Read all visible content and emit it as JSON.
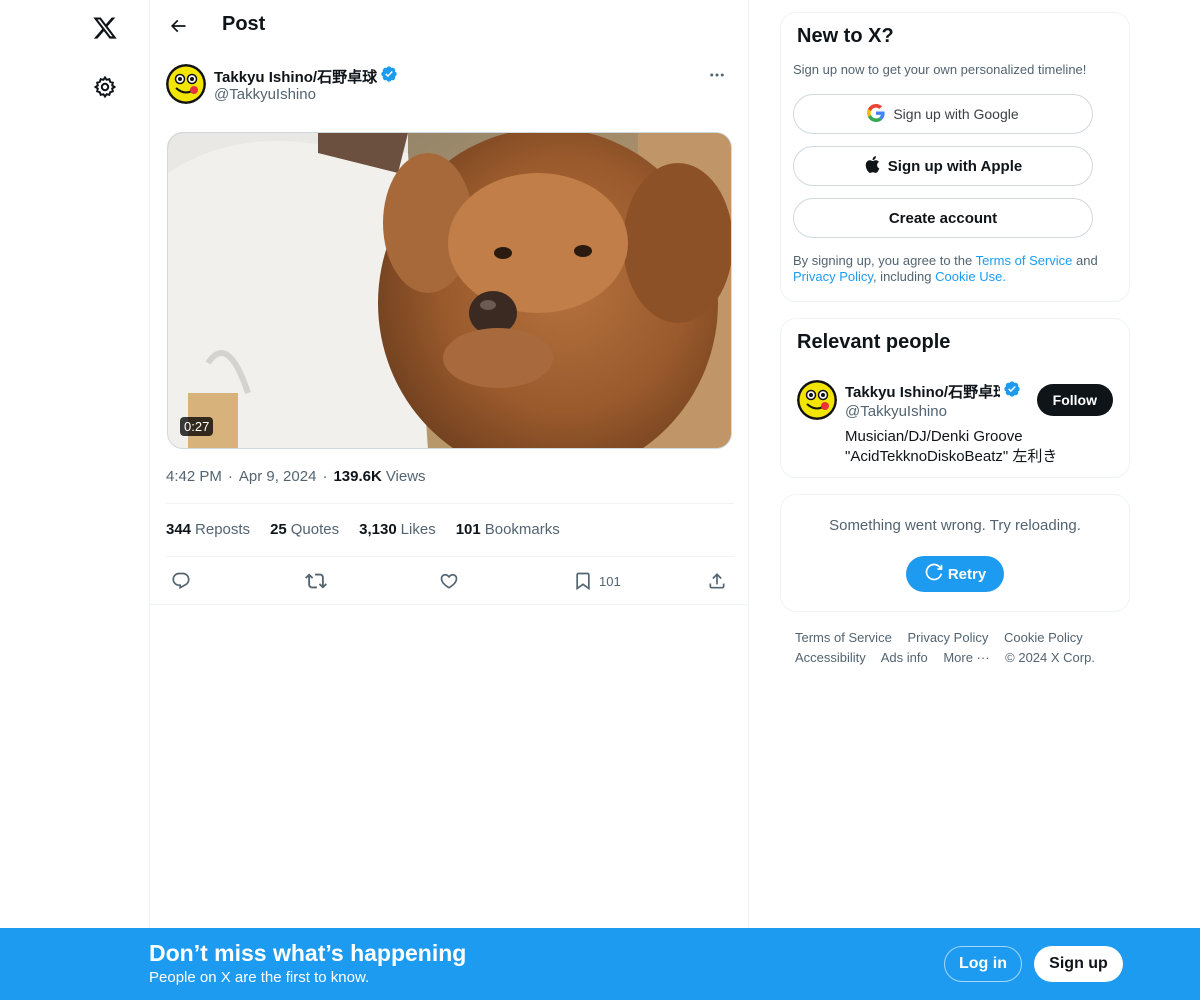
{
  "nav": {
    "logo_icon": "x-logo-icon",
    "settings_icon": "gear-icon"
  },
  "header": {
    "title": "Post",
    "back_icon": "arrow-left-icon"
  },
  "post": {
    "author_name": "Takkyu Ishino/石野卓球",
    "author_handle": "@TakkyuIshino",
    "verified": true,
    "video_duration": "0:27",
    "time": "4:42 PM",
    "date": "Apr 9, 2024",
    "views_count": "139.6K",
    "views_label": "Views",
    "stats": {
      "reposts_count": "344",
      "reposts_label": "Reposts",
      "quotes_count": "25",
      "quotes_label": "Quotes",
      "likes_count": "3,130",
      "likes_label": "Likes",
      "bookmarks_count": "101",
      "bookmarks_label": "Bookmarks"
    },
    "actions": {
      "bookmark_count": "101"
    }
  },
  "sidebar": {
    "new_to_x": {
      "title": "New to X?",
      "subtitle": "Sign up now to get your own personalized timeline!",
      "google_label": "Sign up with Google",
      "apple_label": "Sign up with Apple",
      "create_label": "Create account",
      "legal_prefix": "By signing up, you agree to the ",
      "terms_link": "Terms of Service",
      "legal_and": " and ",
      "privacy_link": "Privacy Policy",
      "legal_including": ", including ",
      "cookie_link": "Cookie Use."
    },
    "relevant_people": {
      "title": "Relevant people",
      "name": "Takkyu Ishino/石野卓球",
      "handle": "@TakkyuIshino",
      "bio": "Musician/DJ/Denki Groove \"AcidTekknoDiskoBeatz\" 左利き",
      "follow_label": "Follow"
    },
    "error_card": {
      "message": "Something went wrong. Try reloading.",
      "retry_label": "Retry"
    },
    "footer": {
      "links": [
        "Terms of Service",
        "Privacy Policy",
        "Cookie Policy",
        "Accessibility",
        "Ads info",
        "More ···"
      ],
      "copyright": "© 2024 X Corp."
    }
  },
  "bottom_bar": {
    "title": "Don’t miss what’s happening",
    "subtitle": "People on X are the first to know.",
    "login_label": "Log in",
    "signup_label": "Sign up"
  },
  "colors": {
    "accent": "#1d9bf0",
    "text": "#0f1419",
    "secondary": "#536471",
    "border": "#eff3f4"
  }
}
